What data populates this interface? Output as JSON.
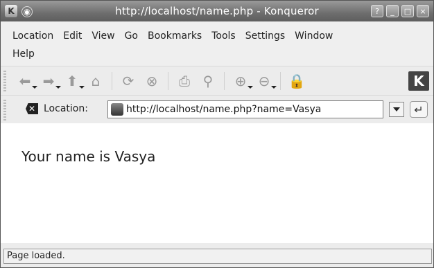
{
  "window": {
    "title": "http://localhost/name.php - Konqueror",
    "controls": [
      "?",
      "_",
      "□",
      "×"
    ]
  },
  "menu": {
    "row1": [
      "Location",
      "Edit",
      "View",
      "Go",
      "Bookmarks",
      "Tools",
      "Settings",
      "Window"
    ],
    "row2": [
      "Help"
    ]
  },
  "toolbar": {
    "icons": [
      "back-arrow",
      "forward-arrow",
      "up-arrow",
      "home",
      "reload",
      "stop",
      "print",
      "find",
      "zoom-in",
      "zoom-out",
      "security"
    ],
    "kde_logo": "K"
  },
  "location": {
    "label": "Location:",
    "value": "http://localhost/name.php?name=Vasya"
  },
  "page": {
    "text": "Your name is Vasya"
  },
  "status": {
    "text": "Page loaded."
  }
}
